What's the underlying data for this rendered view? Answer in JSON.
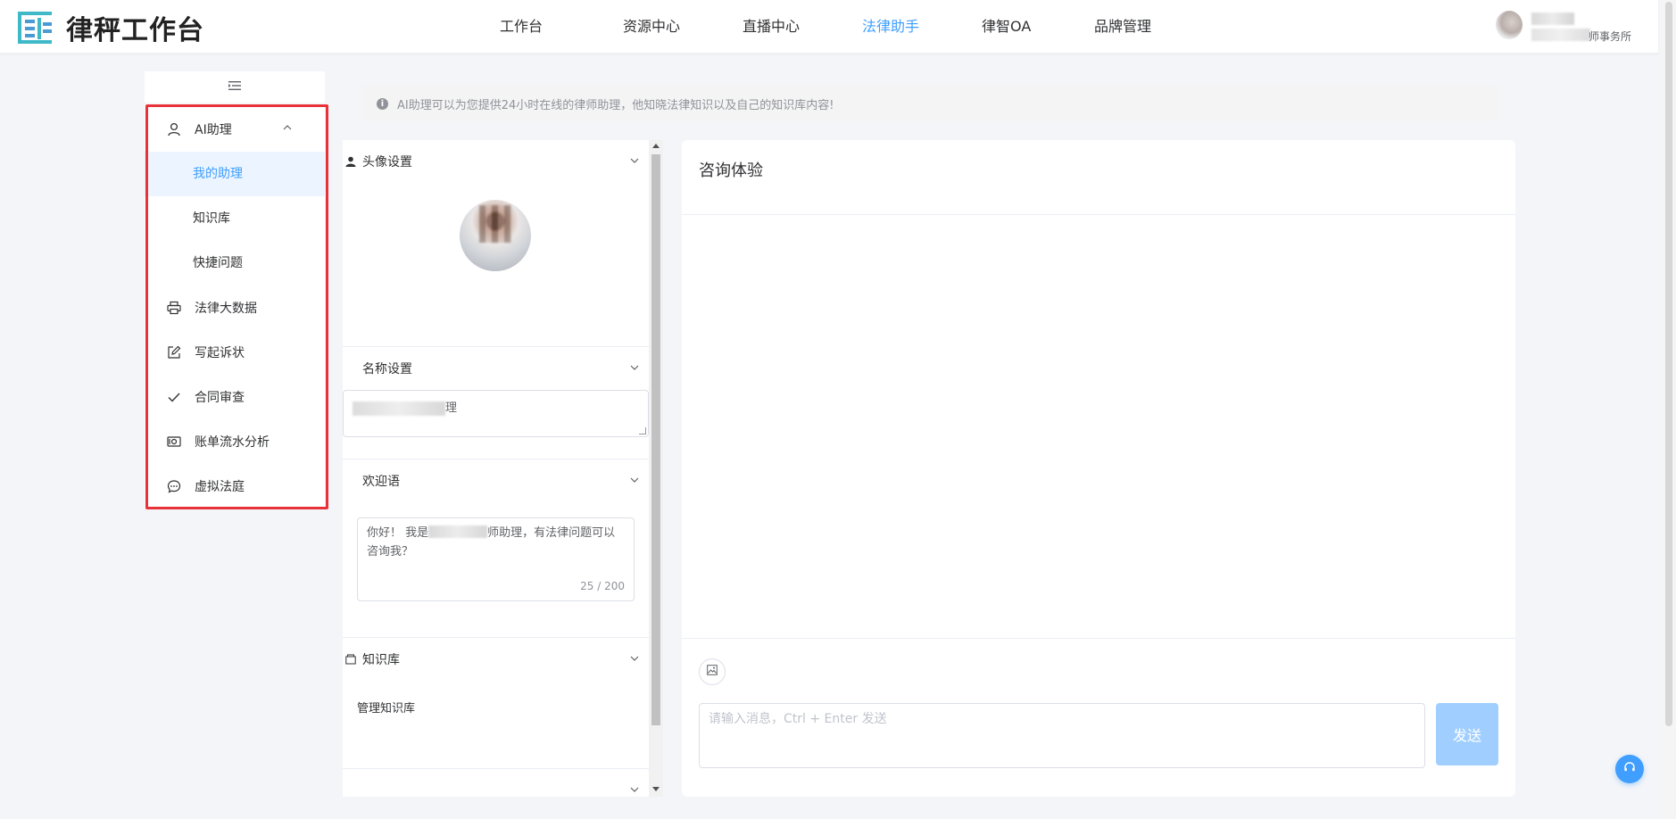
{
  "header": {
    "logo_text": "律秤工作台",
    "nav": [
      {
        "label": "工作台"
      },
      {
        "label": "资源中心"
      },
      {
        "label": "直播中心"
      },
      {
        "label": "法律助手"
      },
      {
        "label": "律智OA"
      },
      {
        "label": "品牌管理"
      }
    ],
    "active_nav_index": 3,
    "user": {
      "firm_suffix": "师事务所"
    }
  },
  "sidebar": {
    "toggle_icon": "menu-fold-icon",
    "group": {
      "label": "AI助理",
      "icon": "user-icon",
      "expanded": true
    },
    "sub_items": [
      {
        "label": "我的助理",
        "active": true
      },
      {
        "label": "知识库"
      },
      {
        "label": "快捷问题"
      }
    ],
    "items": [
      {
        "label": "法律大数据",
        "icon": "printer-icon"
      },
      {
        "label": "写起诉状",
        "icon": "edit-icon"
      },
      {
        "label": "合同审查",
        "icon": "check-icon"
      },
      {
        "label": "账单流水分析",
        "icon": "money-icon"
      },
      {
        "label": "虚拟法庭",
        "icon": "chat-dots-icon"
      }
    ]
  },
  "alert": {
    "text": "AI助理可以为您提供24小时在线的律师助理，他知晓法律知识以及自己的知识库内容!"
  },
  "settings": {
    "avatar_section": {
      "title": "头像设置"
    },
    "name_section": {
      "title": "名称设置",
      "value_suffix": "理"
    },
    "welcome_section": {
      "title": "欢迎语",
      "text_before": "你好！ 我是",
      "text_after": "师助理，有法律问题可以咨询我？",
      "counter": "25 / 200"
    },
    "kb_section": {
      "title": "知识库",
      "link": "管理知识库"
    }
  },
  "chat": {
    "title": "咨询体验",
    "input_placeholder": "请输入消息，Ctrl + Enter 发送",
    "send_label": "发送"
  },
  "colors": {
    "accent": "#409eff",
    "send_disabled": "#a0cfff",
    "highlight_border": "#e8323a"
  }
}
